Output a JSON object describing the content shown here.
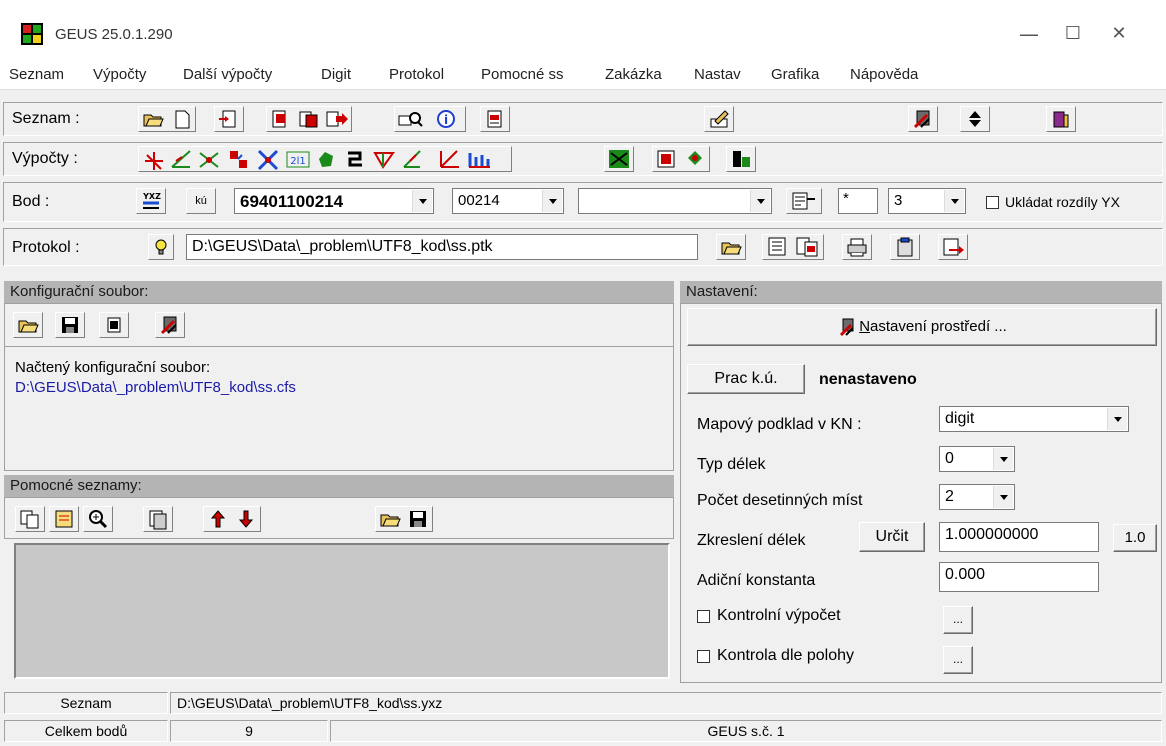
{
  "window": {
    "title": "GEUS 25.0.1.290",
    "minimize": "—",
    "maximize": "☐",
    "close": "✕"
  },
  "menu": [
    "Seznam",
    "Výpočty",
    "Další výpočty",
    "Digit",
    "Protokol",
    "Pomocné ss",
    "Zakázka",
    "Nastav",
    "Grafika",
    "Nápověda"
  ],
  "toolbar_seznam": {
    "label": "Seznam :"
  },
  "toolbar_vypocty": {
    "label": "Výpočty :"
  },
  "toolbar_bod": {
    "label": "Bod :",
    "ku_label": "kú",
    "point_number": "69401100214",
    "point_short": "00214",
    "point_text": "",
    "filter": "*",
    "count": "3",
    "save_diff_label": "Ukládat rozdíly YX"
  },
  "toolbar_protokol": {
    "label": "Protokol :",
    "path": "D:\\GEUS\\Data\\_problem\\UTF8_kod\\ss.ptk"
  },
  "config_panel": {
    "header": "Konfigurační soubor:",
    "loaded_label": "Načtený konfigurační soubor:",
    "loaded_path": "D:\\GEUS\\Data\\_problem\\UTF8_kod\\ss.cfs"
  },
  "aux_panel": {
    "header": "Pomocné seznamy:"
  },
  "settings_panel": {
    "header": "Nastavení:",
    "env_button": "Nastavení prostředí ...",
    "env_button_accel": "N",
    "env_button_rest": "astavení prostředí ...",
    "prac_ku_button": "Prac k.ú.",
    "prac_ku_value": "nenastaveno",
    "map_label": "Mapový podklad v KN :",
    "map_value": "digit",
    "type_label": "Typ délek",
    "type_value": "0",
    "decimals_label": "Počet desetinných míst",
    "decimals_value": "2",
    "scale_label": "Zkreslení délek",
    "scale_button": "Určit",
    "scale_value": "1.000000000",
    "scale_reset": "1.0",
    "additive_label": "Adiční konstanta",
    "additive_value": "0.000",
    "control_calc_label": "Kontrolní výpočet",
    "control_pos_label": "Kontrola dle polohy",
    "ellipsis": "..."
  },
  "status": {
    "list_label": "Seznam",
    "list_path": "D:\\GEUS\\Data\\_problem\\UTF8_kod\\ss.yxz",
    "total_label": "Celkem bodů",
    "total_value": "9",
    "license": "GEUS s.č. 1"
  },
  "colors": {
    "link_blue": "#1a1aa6",
    "header_gray": "#b4b4b4",
    "list_bg": "#c8c8c8"
  }
}
